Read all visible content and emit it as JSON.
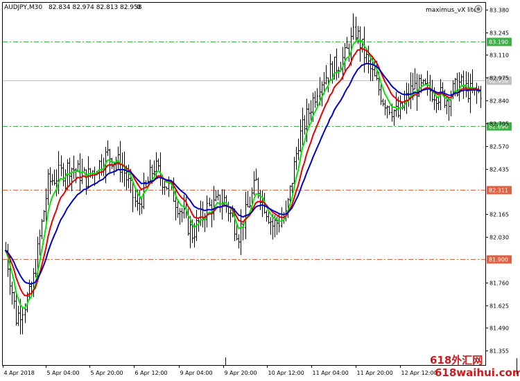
{
  "header": {
    "symbol": "AUDJPY,M30",
    "ohlc": "82.834 82.974 82.813 82.958",
    "volume": "0",
    "indicator_name": "maximus_vX lite"
  },
  "watermark": "618外汇网\n618waihui.com",
  "chart_data": {
    "type": "candlestick-bars",
    "ylim": [
      81.27,
      83.42
    ],
    "y_ticks": [
      "83.380",
      "83.245",
      "83.110",
      "82.975",
      "82.840",
      "82.705",
      "82.570",
      "82.435",
      "82.165",
      "82.030",
      "81.760",
      "81.625",
      "81.490",
      "81.355"
    ],
    "x_ticks": [
      "4 Apr 2018",
      "5 Apr 04:00",
      "5 Apr 20:00",
      "6 Apr 12:00",
      "9 Apr 04:00",
      "9 Apr 20:00",
      "10 Apr 12:00",
      "11 Apr 04:00",
      "11 Apr 20:00",
      "12 Apr 12:00"
    ],
    "levels": [
      {
        "value": 83.19,
        "label": "83.190",
        "color": "#3cb043",
        "style": "dashdot"
      },
      {
        "value": 82.958,
        "label": "82.958",
        "color": "#c0c0c0",
        "style": "solid"
      },
      {
        "value": 82.69,
        "label": "82.690",
        "color": "#3cb043",
        "style": "dashdot"
      },
      {
        "value": 82.311,
        "label": "82.311",
        "color": "#e06040",
        "style": "dashdot"
      },
      {
        "value": 81.9,
        "label": "81.900",
        "color": "#e06040",
        "style": "dashdot"
      }
    ],
    "price_anchors": [
      [
        0,
        81.95
      ],
      [
        5,
        81.55
      ],
      [
        12,
        81.7
      ],
      [
        20,
        82.35
      ],
      [
        30,
        82.45
      ],
      [
        38,
        82.38
      ],
      [
        48,
        82.52
      ],
      [
        55,
        82.45
      ],
      [
        62,
        82.2
      ],
      [
        70,
        82.45
      ],
      [
        78,
        82.3
      ],
      [
        88,
        82.05
      ],
      [
        95,
        82.2
      ],
      [
        103,
        82.25
      ],
      [
        110,
        82.05
      ],
      [
        118,
        82.35
      ],
      [
        126,
        82.1
      ],
      [
        132,
        82.15
      ],
      [
        138,
        82.6
      ],
      [
        148,
        82.95
      ],
      [
        160,
        83.1
      ],
      [
        165,
        83.25
      ],
      [
        171,
        83.05
      ],
      [
        178,
        82.85
      ],
      [
        185,
        82.75
      ],
      [
        192,
        82.92
      ],
      [
        200,
        82.9
      ],
      [
        208,
        82.85
      ],
      [
        214,
        82.94
      ],
      [
        220,
        82.88
      ],
      [
        225,
        82.9
      ]
    ],
    "bar_count": 225,
    "ma_series": [
      {
        "color": "#00e600",
        "period": 3
      },
      {
        "color": "#e60000",
        "period": 6
      },
      {
        "color": "#0000cc",
        "period": 11
      }
    ]
  }
}
